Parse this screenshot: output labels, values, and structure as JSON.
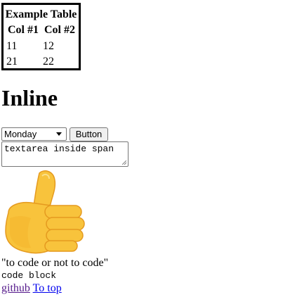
{
  "table": {
    "caption": "Example Table",
    "headers": [
      "Col #1",
      "Col #2"
    ],
    "rows": [
      [
        "11",
        "12"
      ],
      [
        "21",
        "22"
      ]
    ]
  },
  "heading": "Inline",
  "controls": {
    "select_value": "Monday",
    "button_label": "Button",
    "textarea_value": "textarea inside span"
  },
  "image": {
    "icon": "thumbs-up-icon"
  },
  "quote": "\"to code or not to code\"",
  "code_block": "code block",
  "links": {
    "github": "github",
    "to_top": "To top"
  },
  "colors": {
    "link_visited": "#551a8b",
    "link": "#0000ee",
    "thumb_main": "#f8c33c",
    "thumb_shade": "#e59a1f"
  }
}
